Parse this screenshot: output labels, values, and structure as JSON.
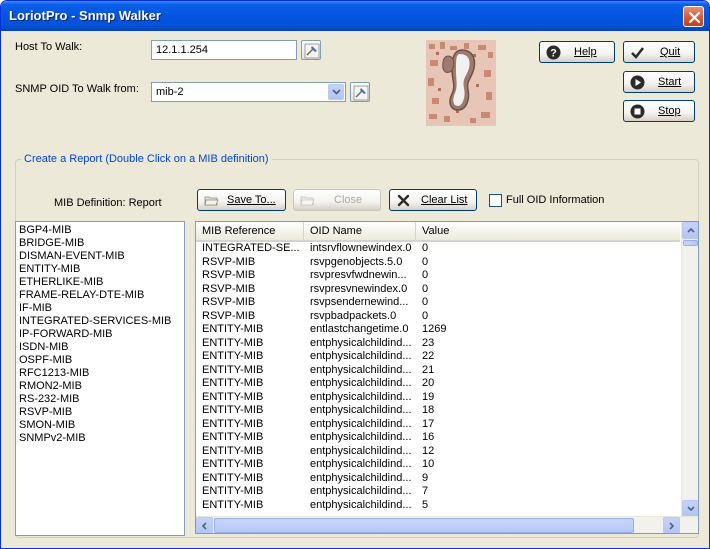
{
  "window": {
    "title": "LoriotPro - Snmp Walker"
  },
  "host": {
    "label": "Host  To Walk:",
    "value": "12.1.1.254"
  },
  "oid": {
    "label": "SNMP OID To Walk from:",
    "value": "mib-2"
  },
  "buttons": {
    "help": "Help",
    "quit": "Quit",
    "start": "Start",
    "stop": "Stop",
    "save_to": "Save To...",
    "close": "Close",
    "clear_list": "Clear List"
  },
  "report": {
    "group_title": "Create a Report  (Double Click on a MIB definition)",
    "mib_def_label": "MIB Definition: Report",
    "full_oid_label": "Full OID Information",
    "full_oid_checked": false
  },
  "mib_list": [
    "BGP4-MIB",
    "BRIDGE-MIB",
    "DISMAN-EVENT-MIB",
    "ENTITY-MIB",
    "ETHERLIKE-MIB",
    "FRAME-RELAY-DTE-MIB",
    "IF-MIB",
    "INTEGRATED-SERVICES-MIB",
    "IP-FORWARD-MIB",
    "ISDN-MIB",
    "OSPF-MIB",
    "RFC1213-MIB",
    "RMON2-MIB",
    "RS-232-MIB",
    "RSVP-MIB",
    "SMON-MIB",
    "SNMPv2-MIB"
  ],
  "results": {
    "columns": [
      "MIB Reference",
      "OID Name",
      "Value"
    ],
    "rows": [
      [
        "INTEGRATED-SE...",
        "intsrvflownewindex.0",
        "0"
      ],
      [
        "RSVP-MIB",
        "rsvpgenobjects.5.0",
        "0"
      ],
      [
        "RSVP-MIB",
        "rsvpresvfwdnewin...",
        "0"
      ],
      [
        "RSVP-MIB",
        "rsvpresvnewindex.0",
        "0"
      ],
      [
        "RSVP-MIB",
        "rsvpsendernewind...",
        "0"
      ],
      [
        "RSVP-MIB",
        "rsvpbadpackets.0",
        "0"
      ],
      [
        "ENTITY-MIB",
        "entlastchangetime.0",
        "1269"
      ],
      [
        "ENTITY-MIB",
        "entphysicalchildind...",
        "23"
      ],
      [
        "ENTITY-MIB",
        "entphysicalchildind...",
        "22"
      ],
      [
        "ENTITY-MIB",
        "entphysicalchildind...",
        "21"
      ],
      [
        "ENTITY-MIB",
        "entphysicalchildind...",
        "20"
      ],
      [
        "ENTITY-MIB",
        "entphysicalchildind...",
        "19"
      ],
      [
        "ENTITY-MIB",
        "entphysicalchildind...",
        "18"
      ],
      [
        "ENTITY-MIB",
        "entphysicalchildind...",
        "17"
      ],
      [
        "ENTITY-MIB",
        "entphysicalchildind...",
        "16"
      ],
      [
        "ENTITY-MIB",
        "entphysicalchildind...",
        "12"
      ],
      [
        "ENTITY-MIB",
        "entphysicalchildind...",
        "10"
      ],
      [
        "ENTITY-MIB",
        "entphysicalchildind...",
        "9"
      ],
      [
        "ENTITY-MIB",
        "entphysicalchildind...",
        "7"
      ],
      [
        "ENTITY-MIB",
        "entphysicalchildind...",
        "5"
      ]
    ]
  },
  "colors": {
    "title_bar": "#0454E0",
    "window_bg": "#ECE9D8",
    "group_title": "#0046D5",
    "close_button": "#D8552F"
  }
}
